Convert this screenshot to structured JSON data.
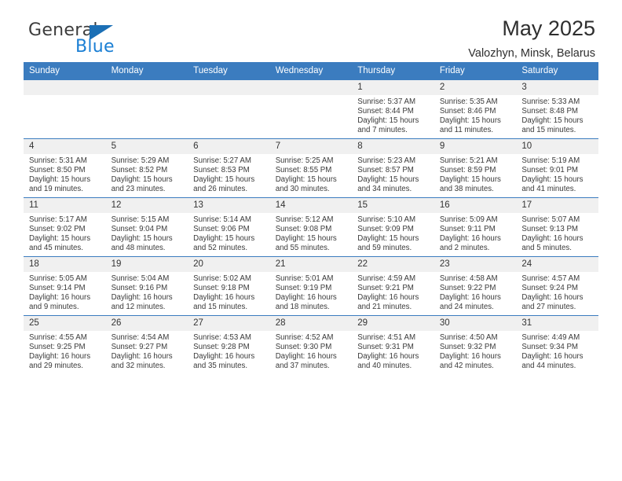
{
  "brand": {
    "word_one": "General",
    "word_two": "Blue",
    "logo_icon": "triangle-flag-icon"
  },
  "header": {
    "month_title": "May 2025",
    "location": "Valozhyn, Minsk, Belarus"
  },
  "calendar": {
    "weekday_headers": [
      "Sunday",
      "Monday",
      "Tuesday",
      "Wednesday",
      "Thursday",
      "Friday",
      "Saturday"
    ],
    "accent_color": "#3b7cbf",
    "daynum_bg": "#f0f0f0",
    "weeks": [
      [
        {
          "day": "",
          "empty": true
        },
        {
          "day": "",
          "empty": true
        },
        {
          "day": "",
          "empty": true
        },
        {
          "day": "",
          "empty": true
        },
        {
          "day": "1",
          "sunrise": "Sunrise: 5:37 AM",
          "sunset": "Sunset: 8:44 PM",
          "daylight": "Daylight: 15 hours and 7 minutes."
        },
        {
          "day": "2",
          "sunrise": "Sunrise: 5:35 AM",
          "sunset": "Sunset: 8:46 PM",
          "daylight": "Daylight: 15 hours and 11 minutes."
        },
        {
          "day": "3",
          "sunrise": "Sunrise: 5:33 AM",
          "sunset": "Sunset: 8:48 PM",
          "daylight": "Daylight: 15 hours and 15 minutes."
        }
      ],
      [
        {
          "day": "4",
          "sunrise": "Sunrise: 5:31 AM",
          "sunset": "Sunset: 8:50 PM",
          "daylight": "Daylight: 15 hours and 19 minutes."
        },
        {
          "day": "5",
          "sunrise": "Sunrise: 5:29 AM",
          "sunset": "Sunset: 8:52 PM",
          "daylight": "Daylight: 15 hours and 23 minutes."
        },
        {
          "day": "6",
          "sunrise": "Sunrise: 5:27 AM",
          "sunset": "Sunset: 8:53 PM",
          "daylight": "Daylight: 15 hours and 26 minutes."
        },
        {
          "day": "7",
          "sunrise": "Sunrise: 5:25 AM",
          "sunset": "Sunset: 8:55 PM",
          "daylight": "Daylight: 15 hours and 30 minutes."
        },
        {
          "day": "8",
          "sunrise": "Sunrise: 5:23 AM",
          "sunset": "Sunset: 8:57 PM",
          "daylight": "Daylight: 15 hours and 34 minutes."
        },
        {
          "day": "9",
          "sunrise": "Sunrise: 5:21 AM",
          "sunset": "Sunset: 8:59 PM",
          "daylight": "Daylight: 15 hours and 38 minutes."
        },
        {
          "day": "10",
          "sunrise": "Sunrise: 5:19 AM",
          "sunset": "Sunset: 9:01 PM",
          "daylight": "Daylight: 15 hours and 41 minutes."
        }
      ],
      [
        {
          "day": "11",
          "sunrise": "Sunrise: 5:17 AM",
          "sunset": "Sunset: 9:02 PM",
          "daylight": "Daylight: 15 hours and 45 minutes."
        },
        {
          "day": "12",
          "sunrise": "Sunrise: 5:15 AM",
          "sunset": "Sunset: 9:04 PM",
          "daylight": "Daylight: 15 hours and 48 minutes."
        },
        {
          "day": "13",
          "sunrise": "Sunrise: 5:14 AM",
          "sunset": "Sunset: 9:06 PM",
          "daylight": "Daylight: 15 hours and 52 minutes."
        },
        {
          "day": "14",
          "sunrise": "Sunrise: 5:12 AM",
          "sunset": "Sunset: 9:08 PM",
          "daylight": "Daylight: 15 hours and 55 minutes."
        },
        {
          "day": "15",
          "sunrise": "Sunrise: 5:10 AM",
          "sunset": "Sunset: 9:09 PM",
          "daylight": "Daylight: 15 hours and 59 minutes."
        },
        {
          "day": "16",
          "sunrise": "Sunrise: 5:09 AM",
          "sunset": "Sunset: 9:11 PM",
          "daylight": "Daylight: 16 hours and 2 minutes."
        },
        {
          "day": "17",
          "sunrise": "Sunrise: 5:07 AM",
          "sunset": "Sunset: 9:13 PM",
          "daylight": "Daylight: 16 hours and 5 minutes."
        }
      ],
      [
        {
          "day": "18",
          "sunrise": "Sunrise: 5:05 AM",
          "sunset": "Sunset: 9:14 PM",
          "daylight": "Daylight: 16 hours and 9 minutes."
        },
        {
          "day": "19",
          "sunrise": "Sunrise: 5:04 AM",
          "sunset": "Sunset: 9:16 PM",
          "daylight": "Daylight: 16 hours and 12 minutes."
        },
        {
          "day": "20",
          "sunrise": "Sunrise: 5:02 AM",
          "sunset": "Sunset: 9:18 PM",
          "daylight": "Daylight: 16 hours and 15 minutes."
        },
        {
          "day": "21",
          "sunrise": "Sunrise: 5:01 AM",
          "sunset": "Sunset: 9:19 PM",
          "daylight": "Daylight: 16 hours and 18 minutes."
        },
        {
          "day": "22",
          "sunrise": "Sunrise: 4:59 AM",
          "sunset": "Sunset: 9:21 PM",
          "daylight": "Daylight: 16 hours and 21 minutes."
        },
        {
          "day": "23",
          "sunrise": "Sunrise: 4:58 AM",
          "sunset": "Sunset: 9:22 PM",
          "daylight": "Daylight: 16 hours and 24 minutes."
        },
        {
          "day": "24",
          "sunrise": "Sunrise: 4:57 AM",
          "sunset": "Sunset: 9:24 PM",
          "daylight": "Daylight: 16 hours and 27 minutes."
        }
      ],
      [
        {
          "day": "25",
          "sunrise": "Sunrise: 4:55 AM",
          "sunset": "Sunset: 9:25 PM",
          "daylight": "Daylight: 16 hours and 29 minutes."
        },
        {
          "day": "26",
          "sunrise": "Sunrise: 4:54 AM",
          "sunset": "Sunset: 9:27 PM",
          "daylight": "Daylight: 16 hours and 32 minutes."
        },
        {
          "day": "27",
          "sunrise": "Sunrise: 4:53 AM",
          "sunset": "Sunset: 9:28 PM",
          "daylight": "Daylight: 16 hours and 35 minutes."
        },
        {
          "day": "28",
          "sunrise": "Sunrise: 4:52 AM",
          "sunset": "Sunset: 9:30 PM",
          "daylight": "Daylight: 16 hours and 37 minutes."
        },
        {
          "day": "29",
          "sunrise": "Sunrise: 4:51 AM",
          "sunset": "Sunset: 9:31 PM",
          "daylight": "Daylight: 16 hours and 40 minutes."
        },
        {
          "day": "30",
          "sunrise": "Sunrise: 4:50 AM",
          "sunset": "Sunset: 9:32 PM",
          "daylight": "Daylight: 16 hours and 42 minutes."
        },
        {
          "day": "31",
          "sunrise": "Sunrise: 4:49 AM",
          "sunset": "Sunset: 9:34 PM",
          "daylight": "Daylight: 16 hours and 44 minutes."
        }
      ]
    ]
  }
}
